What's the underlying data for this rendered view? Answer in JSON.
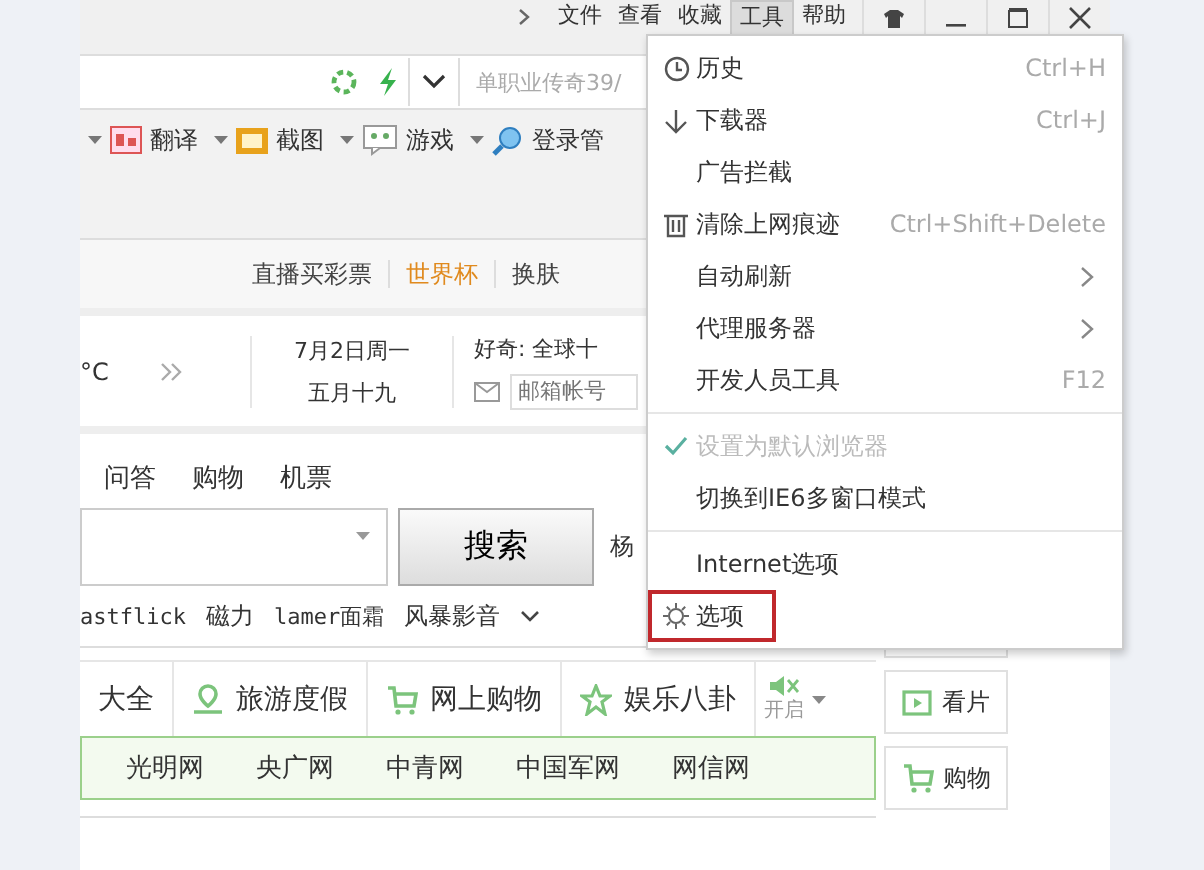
{
  "menubar": {
    "items": [
      {
        "label": "文件",
        "selected": false
      },
      {
        "label": "查看",
        "selected": false
      },
      {
        "label": "收藏",
        "selected": false
      },
      {
        "label": "工具",
        "selected": true
      },
      {
        "label": "帮助",
        "selected": false
      }
    ]
  },
  "address_bar": {
    "search_value": "单职业传奇39/"
  },
  "toolbar": [
    {
      "label": "翻译",
      "kind": "translate"
    },
    {
      "label": "截图",
      "kind": "screenshot"
    },
    {
      "label": "游戏",
      "kind": "game"
    },
    {
      "label": "登录管",
      "kind": "login"
    }
  ],
  "nav_links": [
    {
      "label": "直播买彩票",
      "highlight": false
    },
    {
      "label": "世界杯",
      "highlight": true
    },
    {
      "label": "换肤",
      "highlight": false
    }
  ],
  "weather": {
    "temp": "°C"
  },
  "date": {
    "solar": "7月2日周一",
    "lunar": "五月十九"
  },
  "news": {
    "text": "好奇: 全球十",
    "email_placeholder": "邮箱帐号"
  },
  "search": {
    "tabs": [
      "问答",
      "购物",
      "机票"
    ],
    "button": "搜索",
    "hot": "杨"
  },
  "hot_words": [
    "astflick",
    "磁力",
    "lamer面霜",
    "风暴影音"
  ],
  "categories": [
    {
      "label": "大全",
      "kind": "none"
    },
    {
      "label": "旅游度假",
      "kind": "travel"
    },
    {
      "label": "网上购物",
      "kind": "cart"
    },
    {
      "label": "娱乐八卦",
      "kind": "star"
    }
  ],
  "sound": {
    "label": "开启"
  },
  "sites": [
    "光明网",
    "央广网",
    "中青网",
    "中国军网",
    "网信网"
  ],
  "side_buttons": [
    {
      "label": "看片",
      "kind": "video"
    },
    {
      "label": "购物",
      "kind": "cart"
    }
  ],
  "menu": [
    {
      "kind": "item",
      "label": "历史",
      "shortcut": "Ctrl+H"
    },
    {
      "kind": "item",
      "label": "下载器",
      "shortcut": "Ctrl+J"
    },
    {
      "kind": "item",
      "label": "广告拦截"
    },
    {
      "kind": "item",
      "label": "清除上网痕迹",
      "shortcut": "Ctrl+Shift+Delete"
    },
    {
      "kind": "submenu",
      "label": "自动刷新"
    },
    {
      "kind": "submenu",
      "label": "代理服务器"
    },
    {
      "kind": "item",
      "label": "开发人员工具",
      "shortcut": "F12"
    },
    {
      "kind": "separator"
    },
    {
      "kind": "check",
      "label": "设置为默认浏览器",
      "checked": true,
      "disabled": true
    },
    {
      "kind": "item",
      "label": "切换到IE6多窗口模式"
    },
    {
      "kind": "separator"
    },
    {
      "kind": "item",
      "label": "Internet选项"
    },
    {
      "kind": "item",
      "label": "选项",
      "highlighted": true
    }
  ]
}
